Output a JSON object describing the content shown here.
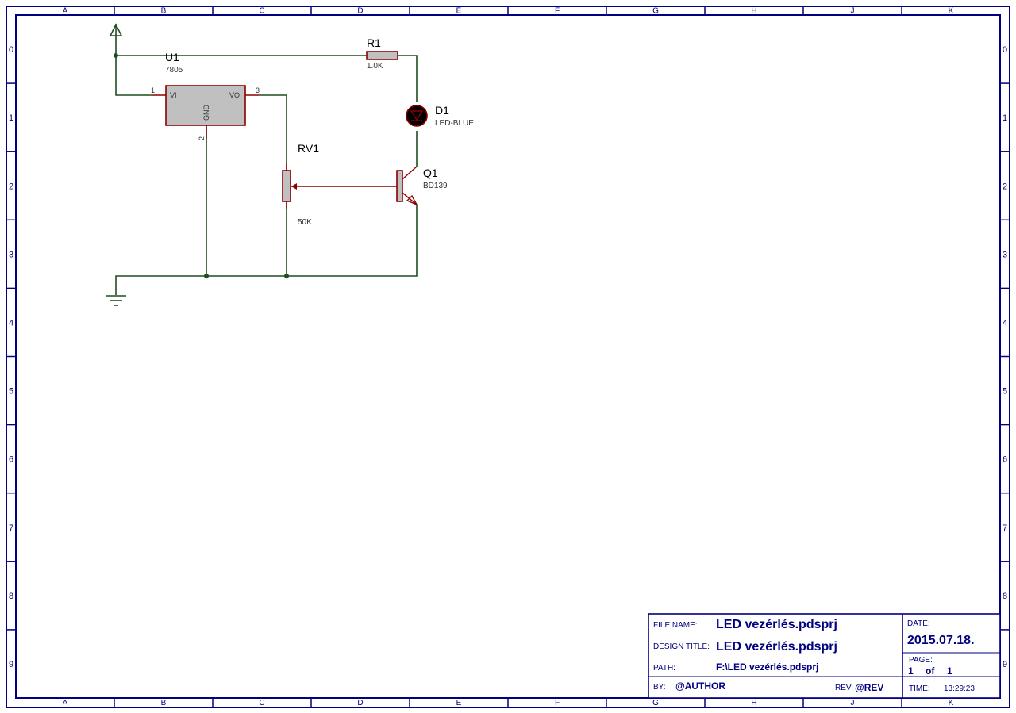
{
  "frame": {
    "columns": [
      "A",
      "B",
      "C",
      "D",
      "E",
      "F",
      "G",
      "H",
      "J",
      "K"
    ],
    "rows": [
      "0",
      "1",
      "2",
      "3",
      "4",
      "5",
      "6",
      "7",
      "8",
      "9"
    ]
  },
  "components": {
    "u1": {
      "ref": "U1",
      "value": "7805",
      "pin1": "1",
      "pin2": "2",
      "pin3": "3",
      "vi": "VI",
      "vo": "VO",
      "gnd": "GND"
    },
    "r1": {
      "ref": "R1",
      "value": "1.0K"
    },
    "d1": {
      "ref": "D1",
      "value": "LED-BLUE"
    },
    "rv1": {
      "ref": "RV1",
      "value": "50K"
    },
    "q1": {
      "ref": "Q1",
      "value": "BD139"
    }
  },
  "title_block": {
    "file_name_label": "FILE NAME:",
    "file_name": "LED vezérlés.pdsprj",
    "design_title_label": "DESIGN TITLE:",
    "design_title": "LED vezérlés.pdsprj",
    "path_label": "PATH:",
    "path": "F:\\LED vezérlés.pdsprj",
    "by_label": "BY:",
    "by": "@AUTHOR",
    "rev_label": "REV:",
    "rev": "@REV",
    "date_label": "DATE:",
    "date": "2015.07.18.",
    "page_label": "PAGE:",
    "page_num": "1",
    "page_of": "of",
    "page_total": "1",
    "time_label": "TIME:",
    "time": "13:29:23"
  },
  "colors": {
    "frame": "#000080",
    "wire": "#1f4d1f",
    "component_outline": "#8b0000",
    "component_fill": "#c0c0c0"
  }
}
